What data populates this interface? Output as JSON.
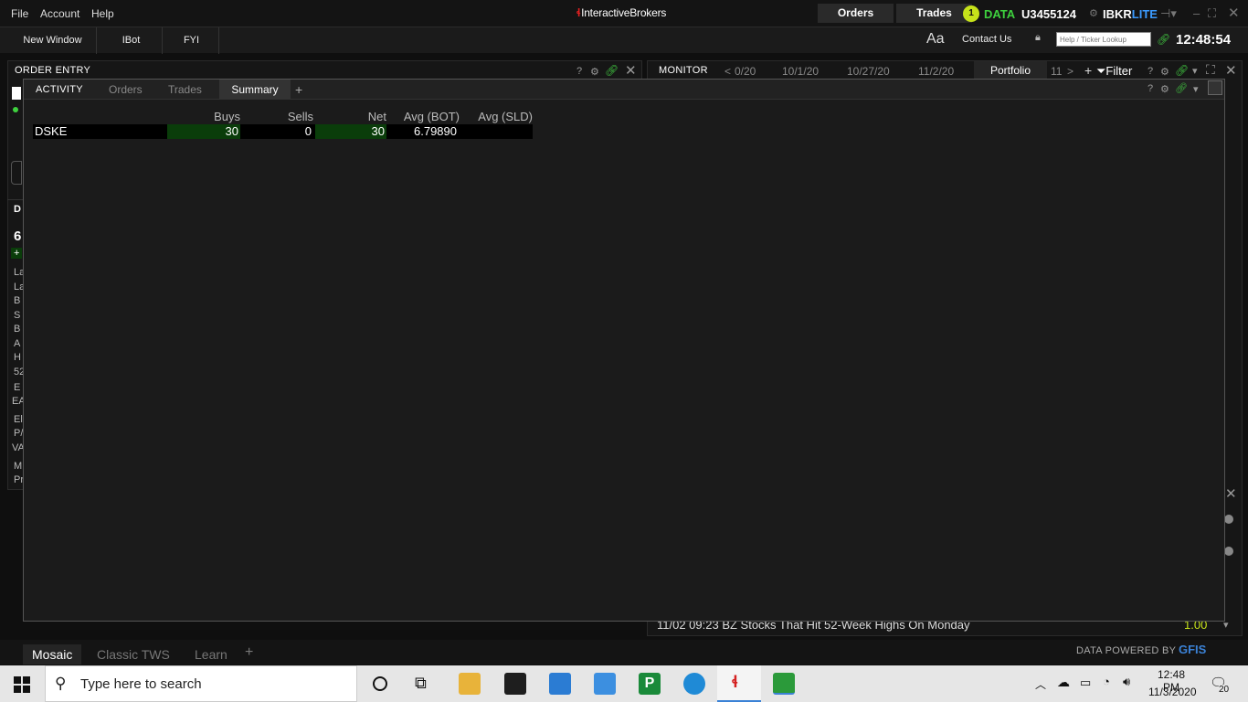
{
  "menu": {
    "file": "File",
    "account": "Account",
    "help": "Help"
  },
  "brand": {
    "mark": "ₐ",
    "name": "InteractiveBrokers"
  },
  "topbar": {
    "orders": "Orders",
    "trades": "Trades",
    "badge": "1",
    "data": "DATA",
    "account_id": "U3455124",
    "ibkr": "IBKR",
    "lite": "LITE"
  },
  "toolbar": {
    "new_window": "New Window",
    "ibot": "IBot",
    "fyi": "FYI",
    "aa": "Aa",
    "contact": "Contact Us",
    "lookup_placeholder": "Help / Ticker Lookup",
    "clock": "12:48:54"
  },
  "order_entry": {
    "title": "ORDER ENTRY",
    "help": "?"
  },
  "monitor": {
    "title": "MONITOR",
    "tabs": [
      "0/20",
      "10/1/20",
      "10/27/20",
      "11/2/20"
    ],
    "active_tab": "Portfolio",
    "overflow_tab": "11",
    "filter": "Filter",
    "help": "?"
  },
  "side_letters": [
    "D",
    "6",
    "+",
    "La",
    "La",
    "B",
    "S",
    "B",
    "A",
    "H",
    "52",
    "E",
    "EA",
    "El",
    "P/",
    "VA",
    "M",
    "Pr"
  ],
  "news": {
    "headline": "11/02 09:23 BZ Stocks That Hit 52-Week Highs On Monday",
    "value": "1.00"
  },
  "activity": {
    "tabs": {
      "activity": "ACTIVITY",
      "orders": "Orders",
      "trades": "Trades",
      "summary": "Summary",
      "add": "+"
    },
    "help": "?",
    "columns": [
      "Buys",
      "Sells",
      "Net",
      "Avg (BOT)",
      "Avg (SLD)"
    ],
    "rows": [
      {
        "symbol": "DSKE",
        "buys": "30",
        "sells": "0",
        "net": "30",
        "avg_bot": "6.79890",
        "avg_sld": ""
      }
    ]
  },
  "bottom_tabs": {
    "mosaic": "Mosaic",
    "classic": "Classic TWS",
    "learn": "Learn",
    "add": "+"
  },
  "powered": {
    "label": "DATA POWERED BY",
    "brand": "GFIS"
  },
  "taskbar": {
    "search": "Type here to search",
    "time": "12:48 PM",
    "date": "11/3/2020",
    "notifications": "20"
  },
  "colors": {
    "accent_green": "#3ed13e",
    "lite_blue": "#3b9bff",
    "badge_yellow": "#c6e21a",
    "cell_green": "#0a3d0a"
  }
}
